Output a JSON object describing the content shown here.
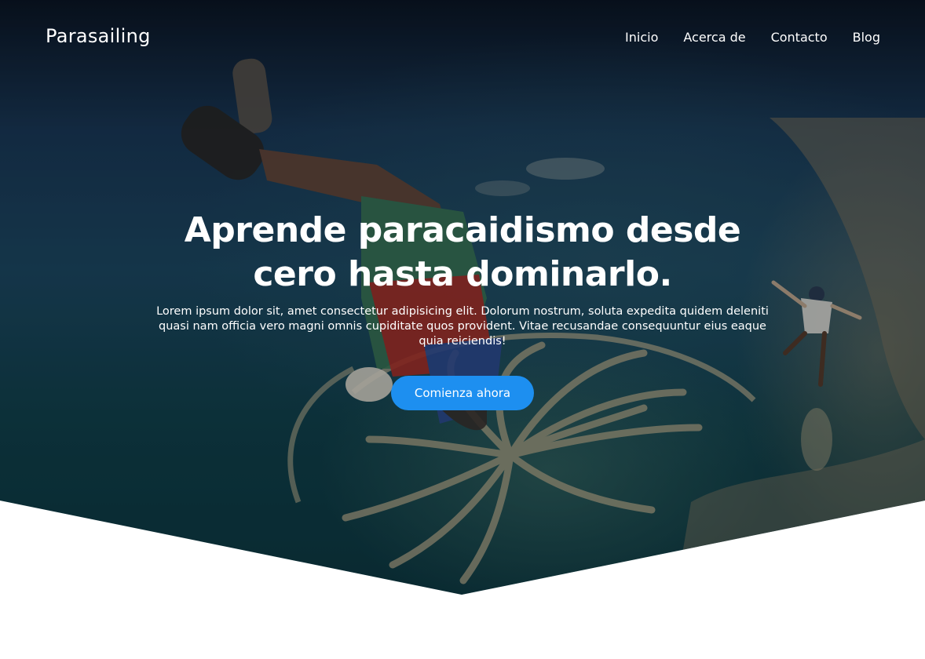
{
  "header": {
    "brand": "Parasailing",
    "nav": [
      "Inicio",
      "Acerca de",
      "Contacto",
      "Blog"
    ]
  },
  "hero": {
    "headline": "Aprende paracaidismo desde cero hasta dominarlo.",
    "lead": "Lorem ipsum dolor sit, amet consectetur adipisicing elit. Dolorum nostrum, soluta expedita quidem deleniti quasi nam officia vero magni omnis cupiditate quos provident. Vitae recusandae consequuntur eius eaque quia reiciendis!",
    "cta_label": "Comienza ahora"
  },
  "colors": {
    "accent": "#1d8ff0",
    "text_on_hero": "#ffffff",
    "page_background": "#ffffff"
  }
}
